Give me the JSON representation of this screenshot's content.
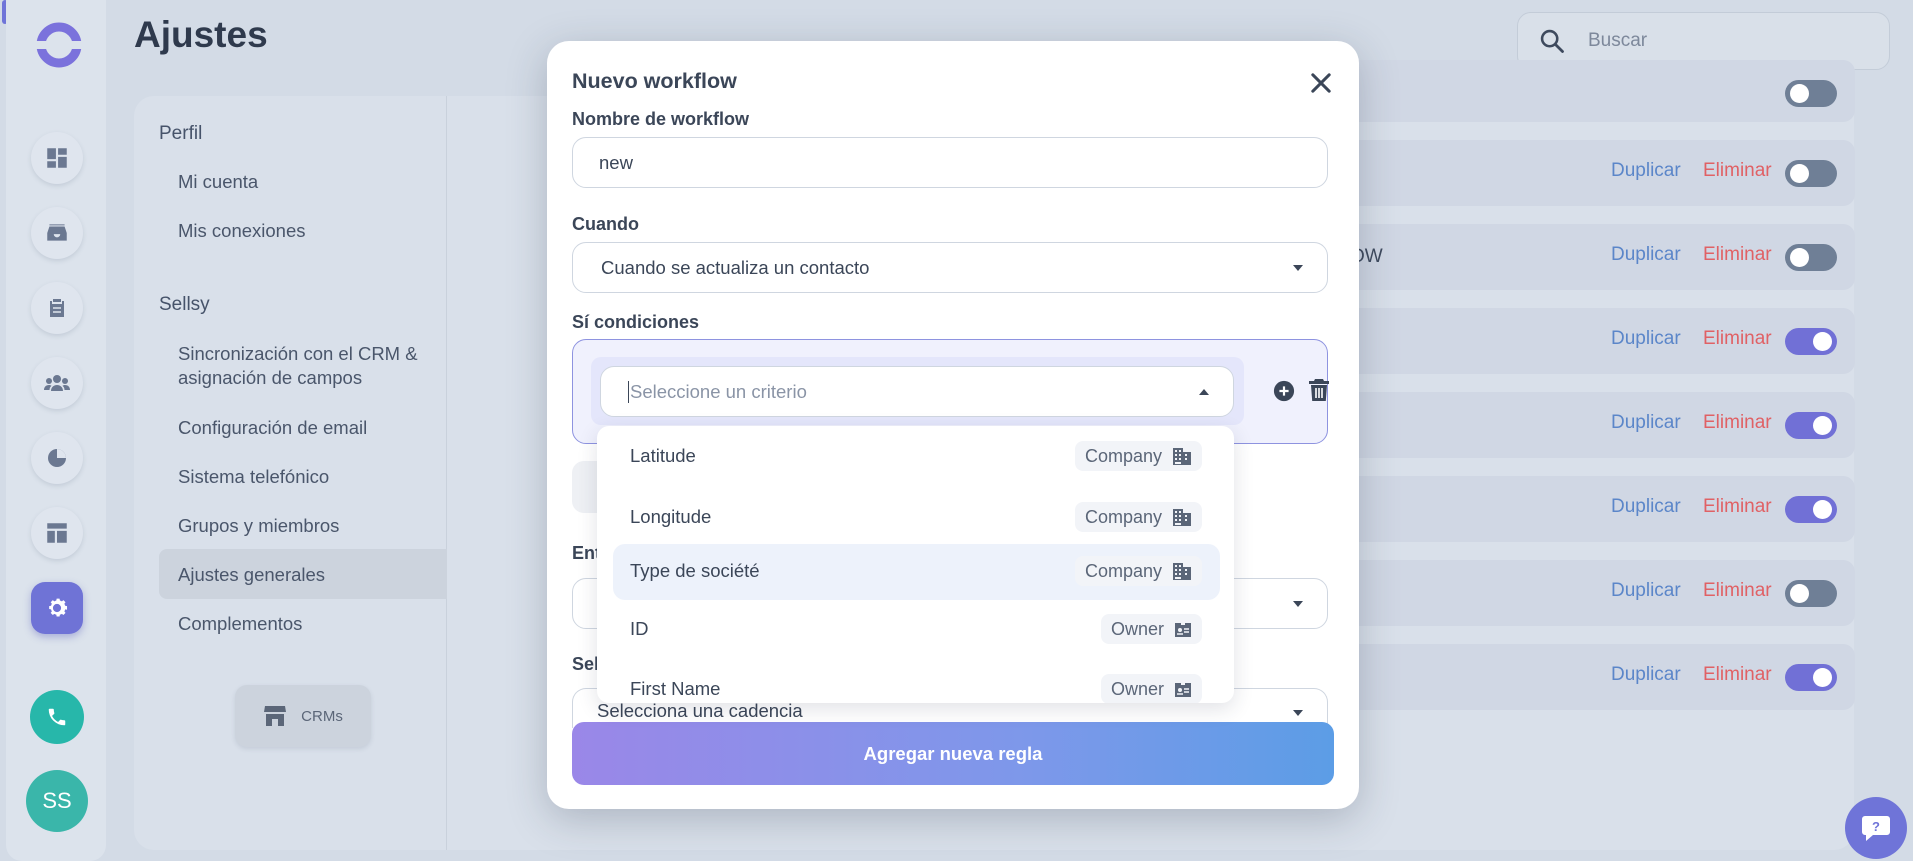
{
  "header": {
    "title": "Ajustes",
    "search_placeholder": "Buscar"
  },
  "rail": {
    "icons": [
      "dashboard-icon",
      "inbox-icon",
      "clipboard-icon",
      "people-icon",
      "pie-chart-icon",
      "layout-icon",
      "gear-icon"
    ],
    "avatar": "SS"
  },
  "settings_nav": {
    "sections": [
      {
        "title": "Perfil",
        "items": [
          "Mi cuenta",
          "Mis conexiones"
        ]
      },
      {
        "title": "Sellsy",
        "items": [
          "Sincronización con el CRM & asignación de campos",
          "Configuración de email",
          "Sistema telefónico",
          "Grupos y miembros",
          "Ajustes generales",
          "Complementos"
        ]
      }
    ],
    "active_item": "Ajustes generales",
    "crm_button": "CRMs"
  },
  "workflows": {
    "duplicate_label": "Duplicar",
    "delete_label": "Eliminar",
    "rows": [
      {
        "fragment": "",
        "enabled": false
      },
      {
        "fragment": "OW",
        "enabled": false
      },
      {
        "fragment": "",
        "enabled": true
      },
      {
        "fragment": "",
        "enabled": true
      },
      {
        "fragment": "",
        "enabled": true
      },
      {
        "fragment": "",
        "enabled": false
      },
      {
        "fragment": "",
        "enabled": true
      }
    ]
  },
  "modal": {
    "title": "Nuevo workflow",
    "name_label": "Nombre de workflow",
    "name_value": "new",
    "when_label": "Cuando",
    "when_value": "Cuando se actualiza un contacto",
    "conditions_label": "Sí condiciones",
    "criteria_placeholder": "Seleccione un criterio",
    "partial_label_1": "Ent",
    "partial_label_2": "Sel",
    "partial_button": "(",
    "cadence_placeholder": "Selecciona una cadencia",
    "submit": "Agregar nueva regla"
  },
  "criteria_options": [
    {
      "name": "Latitude",
      "tag": "Company",
      "icon": "building-icon"
    },
    {
      "name": "Longitude",
      "tag": "Company",
      "icon": "building-icon"
    },
    {
      "name": "Type de société",
      "tag": "Company",
      "icon": "building-icon",
      "highlighted": true
    },
    {
      "name": "ID",
      "tag": "Owner",
      "icon": "id-card-icon"
    },
    {
      "name": "First Name",
      "tag": "Owner",
      "icon": "id-card-icon"
    }
  ],
  "colors": {
    "accent": "#6f73d6",
    "danger": "#e06165",
    "link": "#5b86c9",
    "teal": "#27b7aa"
  }
}
